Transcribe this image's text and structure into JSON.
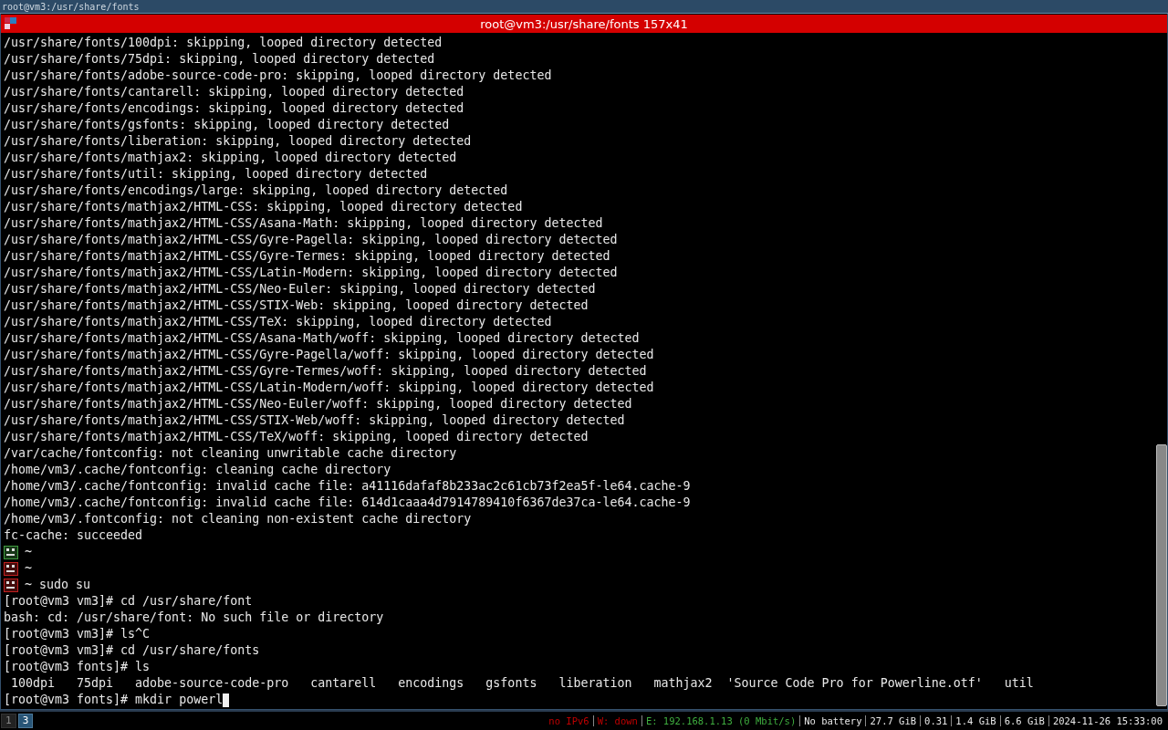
{
  "top_title": "root@vm3:/usr/share/fonts",
  "window": {
    "title": "root@vm3:/usr/share/fonts 157x41"
  },
  "lines": [
    {
      "kind": "text",
      "text": "/usr/share/fonts/100dpi: skipping, looped directory detected"
    },
    {
      "kind": "text",
      "text": "/usr/share/fonts/75dpi: skipping, looped directory detected"
    },
    {
      "kind": "text",
      "text": "/usr/share/fonts/adobe-source-code-pro: skipping, looped directory detected"
    },
    {
      "kind": "text",
      "text": "/usr/share/fonts/cantarell: skipping, looped directory detected"
    },
    {
      "kind": "text",
      "text": "/usr/share/fonts/encodings: skipping, looped directory detected"
    },
    {
      "kind": "text",
      "text": "/usr/share/fonts/gsfonts: skipping, looped directory detected"
    },
    {
      "kind": "text",
      "text": "/usr/share/fonts/liberation: skipping, looped directory detected"
    },
    {
      "kind": "text",
      "text": "/usr/share/fonts/mathjax2: skipping, looped directory detected"
    },
    {
      "kind": "text",
      "text": "/usr/share/fonts/util: skipping, looped directory detected"
    },
    {
      "kind": "text",
      "text": "/usr/share/fonts/encodings/large: skipping, looped directory detected"
    },
    {
      "kind": "text",
      "text": "/usr/share/fonts/mathjax2/HTML-CSS: skipping, looped directory detected"
    },
    {
      "kind": "text",
      "text": "/usr/share/fonts/mathjax2/HTML-CSS/Asana-Math: skipping, looped directory detected"
    },
    {
      "kind": "text",
      "text": "/usr/share/fonts/mathjax2/HTML-CSS/Gyre-Pagella: skipping, looped directory detected"
    },
    {
      "kind": "text",
      "text": "/usr/share/fonts/mathjax2/HTML-CSS/Gyre-Termes: skipping, looped directory detected"
    },
    {
      "kind": "text",
      "text": "/usr/share/fonts/mathjax2/HTML-CSS/Latin-Modern: skipping, looped directory detected"
    },
    {
      "kind": "text",
      "text": "/usr/share/fonts/mathjax2/HTML-CSS/Neo-Euler: skipping, looped directory detected"
    },
    {
      "kind": "text",
      "text": "/usr/share/fonts/mathjax2/HTML-CSS/STIX-Web: skipping, looped directory detected"
    },
    {
      "kind": "text",
      "text": "/usr/share/fonts/mathjax2/HTML-CSS/TeX: skipping, looped directory detected"
    },
    {
      "kind": "text",
      "text": "/usr/share/fonts/mathjax2/HTML-CSS/Asana-Math/woff: skipping, looped directory detected"
    },
    {
      "kind": "text",
      "text": "/usr/share/fonts/mathjax2/HTML-CSS/Gyre-Pagella/woff: skipping, looped directory detected"
    },
    {
      "kind": "text",
      "text": "/usr/share/fonts/mathjax2/HTML-CSS/Gyre-Termes/woff: skipping, looped directory detected"
    },
    {
      "kind": "text",
      "text": "/usr/share/fonts/mathjax2/HTML-CSS/Latin-Modern/woff: skipping, looped directory detected"
    },
    {
      "kind": "text",
      "text": "/usr/share/fonts/mathjax2/HTML-CSS/Neo-Euler/woff: skipping, looped directory detected"
    },
    {
      "kind": "text",
      "text": "/usr/share/fonts/mathjax2/HTML-CSS/STIX-Web/woff: skipping, looped directory detected"
    },
    {
      "kind": "text",
      "text": "/usr/share/fonts/mathjax2/HTML-CSS/TeX/woff: skipping, looped directory detected"
    },
    {
      "kind": "text",
      "text": "/var/cache/fontconfig: not cleaning unwritable cache directory"
    },
    {
      "kind": "text",
      "text": "/home/vm3/.cache/fontconfig: cleaning cache directory"
    },
    {
      "kind": "text",
      "text": "/home/vm3/.cache/fontconfig: invalid cache file: a41116dafaf8b233ac2c61cb73f2ea5f-le64.cache-9"
    },
    {
      "kind": "text",
      "text": "/home/vm3/.cache/fontconfig: invalid cache file: 614d1caaa4d7914789410f6367de37ca-le64.cache-9"
    },
    {
      "kind": "text",
      "text": "/home/vm3/.fontconfig: not cleaning non-existent cache directory"
    },
    {
      "kind": "text",
      "text": "fc-cache: succeeded"
    },
    {
      "kind": "prompt",
      "color": "#3f9a3f",
      "text": "~"
    },
    {
      "kind": "prompt",
      "color": "#c02020",
      "text": "~"
    },
    {
      "kind": "prompt",
      "color": "#c02020",
      "text": "~ sudo su"
    },
    {
      "kind": "text",
      "text": "[root@vm3 vm3]# cd /usr/share/font"
    },
    {
      "kind": "text",
      "text": "bash: cd: /usr/share/font: No such file or directory"
    },
    {
      "kind": "text",
      "text": "[root@vm3 vm3]# ls^C"
    },
    {
      "kind": "text",
      "text": "[root@vm3 vm3]# cd /usr/share/fonts"
    },
    {
      "kind": "text",
      "text": "[root@vm3 fonts]# ls"
    },
    {
      "kind": "text",
      "text": " 100dpi   75dpi   adobe-source-code-pro   cantarell   encodings   gsfonts   liberation   mathjax2  'Source Code Pro for Powerline.otf'   util"
    },
    {
      "kind": "input",
      "text": "[root@vm3 fonts]# mkdir powerl"
    }
  ],
  "workspaces": [
    {
      "label": "1",
      "selected": false
    },
    {
      "label": "3",
      "selected": true
    }
  ],
  "status": [
    {
      "text": "no IPv6",
      "color": "#c00000"
    },
    {
      "text": "W: down",
      "color": "#c00000"
    },
    {
      "text": "E: 192.168.1.13 (0 Mbit/s)",
      "color": "#3fae3f"
    },
    {
      "text": "No battery",
      "color": "#e8e8e8"
    },
    {
      "text": "27.7 GiB",
      "color": "#e8e8e8"
    },
    {
      "text": "0.31",
      "color": "#e8e8e8"
    },
    {
      "text": "1.4 GiB",
      "color": "#e8e8e8"
    },
    {
      "text": "6.6 GiB",
      "color": "#e8e8e8"
    },
    {
      "text": "2024-11-26 15:33:00",
      "color": "#e8e8e8"
    }
  ]
}
